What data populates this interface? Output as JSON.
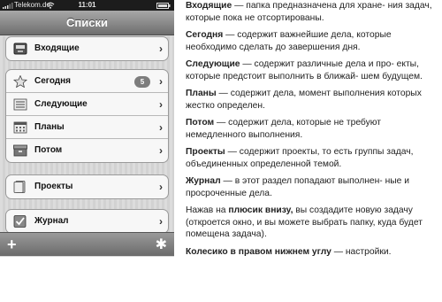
{
  "status_bar": {
    "carrier": "Telekom.de",
    "time": "11:01"
  },
  "nav": {
    "title": "Списки"
  },
  "groups": [
    {
      "items": [
        {
          "label": "Входящие",
          "icon": "inbox-tray-icon"
        }
      ]
    },
    {
      "items": [
        {
          "label": "Сегодня",
          "icon": "star-icon",
          "badge": "5"
        },
        {
          "label": "Следующие",
          "icon": "stacked-list-icon"
        },
        {
          "label": "Планы",
          "icon": "calendar-icon"
        },
        {
          "label": "Потом",
          "icon": "storage-box-icon"
        }
      ]
    },
    {
      "items": [
        {
          "label": "Проекты",
          "icon": "folder-icon"
        }
      ]
    },
    {
      "items": [
        {
          "label": "Журнал",
          "icon": "checkbox-icon"
        }
      ]
    }
  ],
  "toolbar": {
    "add_icon": "plus-icon",
    "settings_icon": "gear-icon"
  },
  "description": [
    {
      "term": "Входящие",
      "text": " — папка предназначена для хране- ния задач, которые пока не отсортированы."
    },
    {
      "term": "Сегодня",
      "text": " — содержит важнейшие дела, которые необходимо сделать до завершения дня."
    },
    {
      "term": "Следующие",
      "text": " — содержит различные дела и про- екты, которые предстоит выполнить в ближай- шем будущем."
    },
    {
      "term": "Планы",
      "text": " — содержит дела, момент выполнения которых жестко определен."
    },
    {
      "term": "Потом",
      "text": " — содержит дела, которые не требуют немедленного выполнения."
    },
    {
      "term": "Проекты",
      "text": " — содержит проекты, то есть группы задач, объединенных определенной темой."
    },
    {
      "term": "Журнал",
      "text": " — в этот раздел попадают выполнен- ные и просроченные дела."
    },
    {
      "prefix": "Нажав на ",
      "term": "плюсик внизу,",
      "text": " вы создадите новую задачу (откроется окно, и вы можете выбрать папку, куда будет помещена задача)."
    },
    {
      "term": "Колесико в правом нижнем углу",
      "text": " — настройки."
    }
  ]
}
